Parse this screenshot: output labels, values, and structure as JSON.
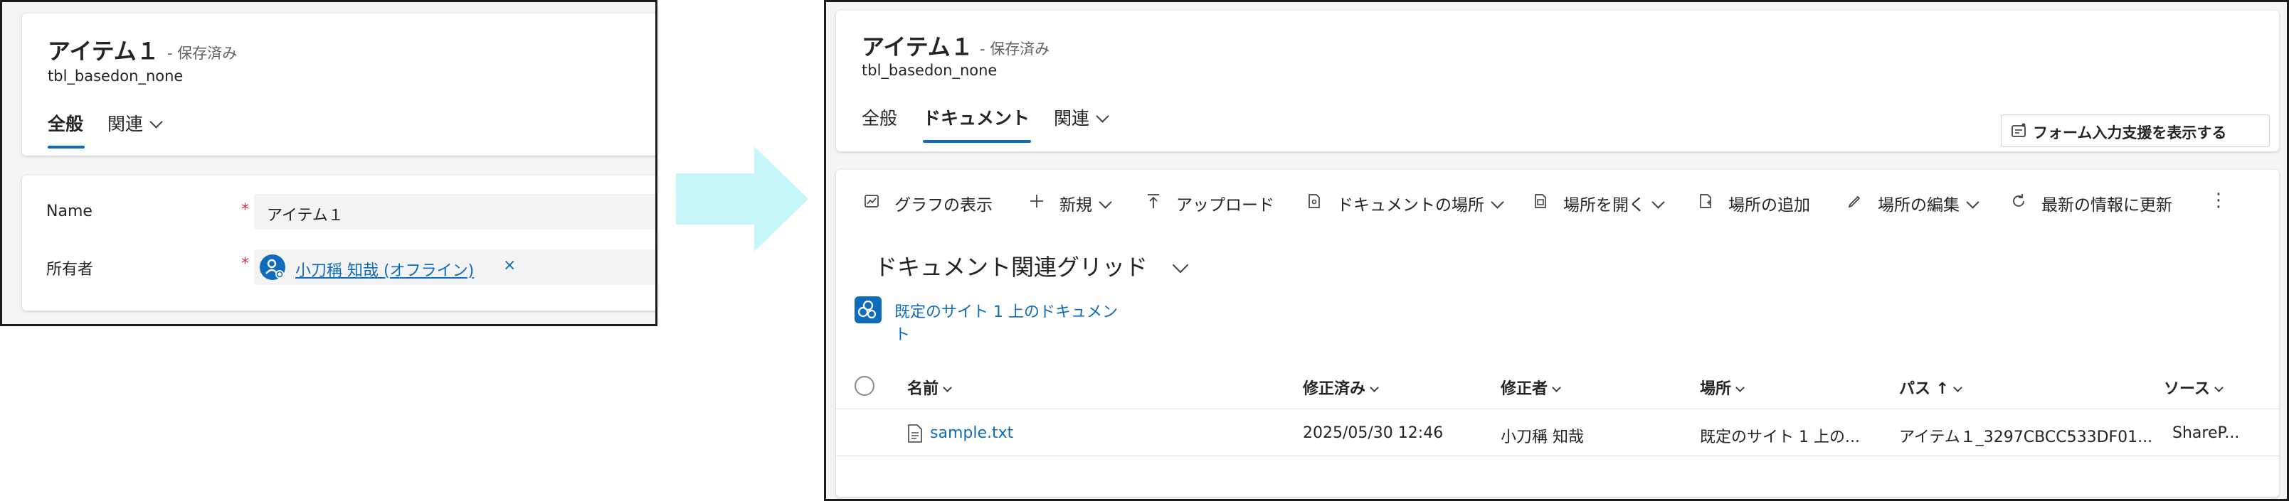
{
  "left": {
    "title": "アイテム１",
    "saved": "- 保存済み",
    "entity": "tbl_basedon_none",
    "tabs": [
      "全般",
      "関連"
    ],
    "fields": {
      "name_label": "Name",
      "name_value": "アイテム１",
      "owner_label": "所有者",
      "owner_value": "小刀稱 知哉 (オフライン)",
      "required_mark": "*",
      "remove_glyph": "×"
    }
  },
  "right": {
    "title": "アイテム１",
    "saved": "- 保存済み",
    "entity": "tbl_basedon_none",
    "tabs": [
      "全般",
      "ドキュメント",
      "関連"
    ],
    "form_assist": "フォーム入力支援を表示する",
    "toolbar": {
      "graph": "グラフの表示",
      "new": "新規",
      "upload": "アップロード",
      "doc_location": "ドキュメントの場所",
      "open_location": "場所を開く",
      "add_location": "場所の追加",
      "edit_location": "場所の編集",
      "refresh": "最新の情報に更新",
      "more": "⋮"
    },
    "grid_title": "ドキュメント関連グリッド",
    "site_link_line1": "既定のサイト 1 上のドキュメン",
    "site_link_line2": "ト",
    "columns": {
      "name": "名前",
      "modified": "修正済み",
      "modified_by": "修正者",
      "location": "場所",
      "path": "パス ↑",
      "source": "ソース"
    },
    "rows": [
      {
        "name": "sample.txt",
        "modified": "2025/05/30 12:46",
        "modified_by": "小刀稱  知哉",
        "location": "既定のサイト 1 上の...",
        "path": "アイテム１_3297CBCC533DF01...",
        "source": "ShareP..."
      }
    ]
  },
  "colors": {
    "accent": "#0f6cbd",
    "arrow": "#c5f6fa",
    "required": "#c4314b"
  }
}
